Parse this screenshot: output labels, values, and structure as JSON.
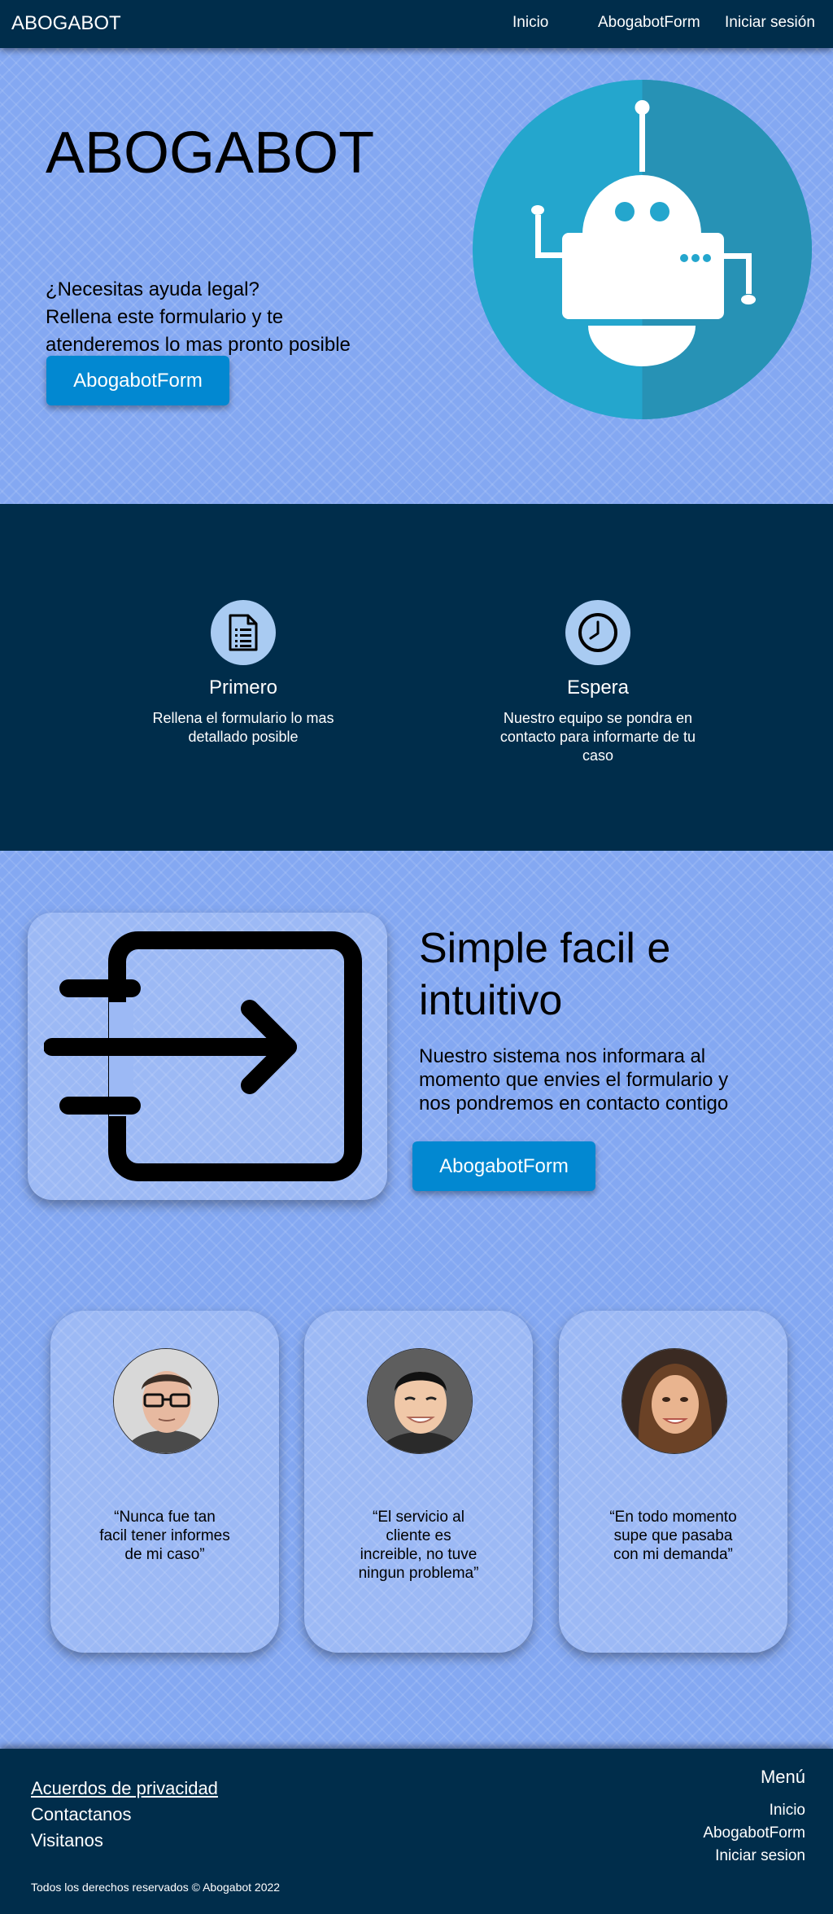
{
  "nav": {
    "brand": "ABOGABOT",
    "links": [
      "Inicio",
      "AbogabotForm",
      "Iniciar sesión"
    ]
  },
  "hero": {
    "title": "ABOGABOT",
    "lines": [
      "¿Necesitas ayuda legal?",
      "Rellena este formulario y te",
      "atenderemos lo mas pronto posible"
    ],
    "button": "AbogabotForm",
    "image_icon": "robot-icon"
  },
  "steps": [
    {
      "icon": "document-list-icon",
      "title": "Primero",
      "text": "Rellena el formulario lo mas detallado posible"
    },
    {
      "icon": "clock-icon",
      "title": "Espera",
      "text": "Nuestro equipo se pondra en contacto para informarte de tu caso"
    }
  ],
  "feature": {
    "icon": "exit-arrow-icon",
    "title": "Simple facil e intuitivo",
    "text": "Nuestro sistema nos informara al momento que envies el formulario y nos pondremos en contacto contigo",
    "button": "AbogabotForm"
  },
  "testimonials": [
    {
      "quote": "“Nunca fue tan facil tener informes de mi caso”",
      "avatar": "man-glasses-avatar"
    },
    {
      "quote": "“El servicio al cliente es increible, no tuve ningun problema”",
      "avatar": "young-man-avatar"
    },
    {
      "quote": "“En todo momento supe que pasaba con mi demanda”",
      "avatar": "woman-avatar"
    }
  ],
  "footer": {
    "links": [
      "Acuerdos de privacidad",
      "Contactanos",
      "Visitanos"
    ],
    "menu_title": "Menú",
    "menu": [
      "Inicio",
      "AbogabotForm",
      "Iniciar sesion"
    ],
    "copyright": "Todos los derechos reservados © Abogabot 2022"
  },
  "colors": {
    "navy": "#002d4b",
    "page_blue": "#84a8f2",
    "button_blue": "#0288d1",
    "robot_circle": "#24a6cd"
  }
}
